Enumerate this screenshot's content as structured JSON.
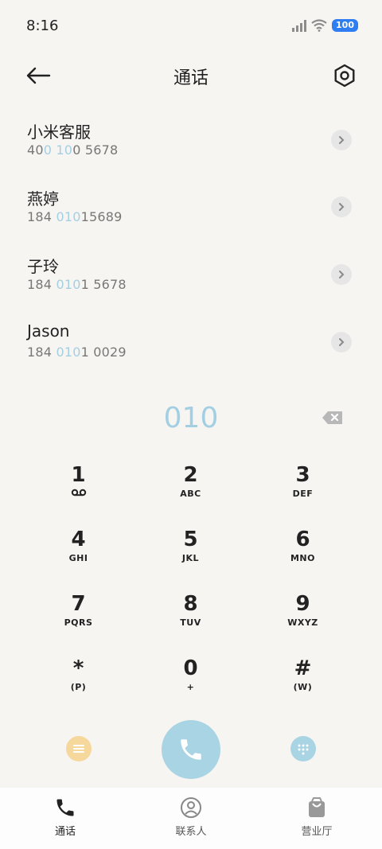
{
  "status": {
    "time": "8:16",
    "battery": "100"
  },
  "header": {
    "title": "通话"
  },
  "contacts": [
    {
      "name": "小米客服",
      "num_parts": [
        "40",
        "0 10",
        "0 5678"
      ]
    },
    {
      "name": "燕婷",
      "num_parts": [
        "184 ",
        "010",
        "15689"
      ]
    },
    {
      "name": "子玲",
      "num_parts": [
        "184 ",
        "010",
        "1 5678"
      ]
    },
    {
      "name": "Jason",
      "num_parts": [
        "184 ",
        "010",
        "1 0029"
      ]
    }
  ],
  "dialer": {
    "input": "010"
  },
  "keys": [
    {
      "digit": "1",
      "sub": ""
    },
    {
      "digit": "2",
      "sub": "ABC"
    },
    {
      "digit": "3",
      "sub": "DEF"
    },
    {
      "digit": "4",
      "sub": "GHI"
    },
    {
      "digit": "5",
      "sub": "JKL"
    },
    {
      "digit": "6",
      "sub": "MNO"
    },
    {
      "digit": "7",
      "sub": "PQRS"
    },
    {
      "digit": "8",
      "sub": "TUV"
    },
    {
      "digit": "9",
      "sub": "WXYZ"
    },
    {
      "digit": "*",
      "sub": "(P)"
    },
    {
      "digit": "0",
      "sub": "+"
    },
    {
      "digit": "#",
      "sub": "(W)"
    }
  ],
  "nav": [
    {
      "label": "通话",
      "icon": "phone-icon"
    },
    {
      "label": "联系人",
      "icon": "contact-icon"
    },
    {
      "label": "营业厅",
      "icon": "bag-icon"
    }
  ],
  "colors": {
    "highlight": "#a3cfe3",
    "call": "#a9d4e3",
    "menu": "#f6d79c",
    "battery": "#2f7df3"
  }
}
